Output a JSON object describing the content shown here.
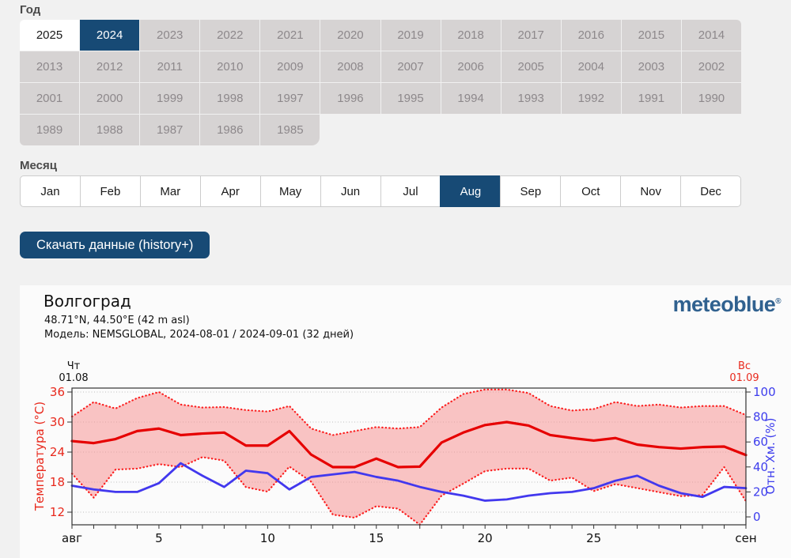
{
  "colors": {
    "accent_navy": "#174a75",
    "page_background": "#f1f1f1",
    "year_cell_gray": "#d6d3d3",
    "temperature_red": "#e8291d",
    "humidity_blue": "#3d3ded",
    "logo_blue": "#30618f"
  },
  "year_section": {
    "label": "Год",
    "selected": "2024",
    "highlighted": "2025",
    "years": [
      "2025",
      "2024",
      "2023",
      "2022",
      "2021",
      "2020",
      "2019",
      "2018",
      "2017",
      "2016",
      "2015",
      "2014",
      "2013",
      "2012",
      "2011",
      "2010",
      "2009",
      "2008",
      "2007",
      "2006",
      "2005",
      "2004",
      "2003",
      "2002",
      "2001",
      "2000",
      "1999",
      "1998",
      "1997",
      "1996",
      "1995",
      "1994",
      "1993",
      "1992",
      "1991",
      "1990",
      "1989",
      "1988",
      "1987",
      "1986",
      "1985"
    ]
  },
  "month_section": {
    "label": "Месяц",
    "selected": "Aug",
    "months": [
      "Jan",
      "Feb",
      "Mar",
      "Apr",
      "May",
      "Jun",
      "Jul",
      "Aug",
      "Sep",
      "Oct",
      "Nov",
      "Dec"
    ]
  },
  "download_button": {
    "label": "Скачать данные (history+)"
  },
  "chart_header": {
    "title": "Волгоград",
    "coords": "48.71°N, 44.50°E (42 m asl)",
    "model": "Модель: NEMSGLOBAL, 2024-08-01 / 2024-09-01 (32 дней)",
    "logo": "meteoblue",
    "logo_mark": "®"
  },
  "chart_data": {
    "type": "line",
    "title": "Волгоград",
    "x_start": "2024-08-01",
    "x_end": "2024-09-01",
    "days_count": 32,
    "grid": true,
    "x_label_start": {
      "weekday": "Чт",
      "date": "01.08",
      "color": "#111111"
    },
    "x_label_end": {
      "weekday": "Вс",
      "date": "01.09",
      "color": "#e8291d"
    },
    "y_left": {
      "label": "Температура (°C)",
      "ticks": [
        36,
        30,
        24,
        18,
        12
      ],
      "color": "#e8291d",
      "ylim": [
        9.3,
        36.8
      ]
    },
    "y_right": {
      "label": "Отн. Хм. (%)",
      "ticks": [
        100,
        80,
        60,
        40,
        20,
        0
      ],
      "color": "#3d3ded",
      "ylim": [
        -6,
        103
      ]
    },
    "x_ticks": [
      {
        "pos": 1,
        "label": "авг"
      },
      {
        "pos": 5,
        "label": "5"
      },
      {
        "pos": 10,
        "label": "10"
      },
      {
        "pos": 15,
        "label": "15"
      },
      {
        "pos": 20,
        "label": "20"
      },
      {
        "pos": 25,
        "label": "25"
      },
      {
        "pos": 32,
        "label": "сен"
      }
    ],
    "band": {
      "between": [
        "temp_max",
        "temp_min"
      ],
      "fill": "rgba(247,140,140,0.5)"
    },
    "series": [
      {
        "name": "temp_mean",
        "axis": "left",
        "style": "solid",
        "color": "#e60000",
        "values": [
          26.2,
          25.8,
          26.6,
          28.2,
          28.7,
          27.4,
          27.7,
          27.9,
          25.3,
          25.3,
          28.2,
          23.5,
          21.0,
          21.0,
          22.7,
          21.0,
          21.1,
          25.9,
          27.9,
          29.4,
          30.0,
          29.3,
          27.4,
          26.8,
          26.3,
          26.8,
          25.5,
          25.0,
          24.7,
          25.0,
          25.1,
          23.4
        ]
      },
      {
        "name": "temp_max",
        "axis": "left",
        "style": "dotted",
        "color": "#fb2020",
        "values": [
          31.1,
          34.0,
          32.7,
          34.8,
          36.0,
          33.5,
          32.9,
          33.0,
          32.4,
          32.1,
          33.2,
          28.7,
          27.4,
          28.2,
          29.0,
          28.7,
          29.0,
          32.9,
          35.6,
          36.5,
          36.5,
          35.8,
          33.2,
          32.3,
          32.6,
          34.0,
          33.2,
          33.5,
          32.9,
          33.2,
          33.2,
          31.4
        ]
      },
      {
        "name": "temp_min",
        "axis": "left",
        "style": "dotted",
        "color": "#fb2020",
        "values": [
          19.7,
          14.9,
          20.5,
          20.7,
          21.6,
          21.0,
          23.0,
          22.3,
          17.0,
          16.1,
          21.1,
          18.1,
          11.5,
          10.9,
          13.2,
          12.7,
          9.5,
          15.3,
          17.7,
          20.2,
          20.7,
          20.7,
          18.3,
          18.9,
          16.2,
          17.6,
          16.8,
          16.0,
          15.2,
          15.4,
          21.0,
          14.2
        ]
      },
      {
        "name": "humidity",
        "axis": "right",
        "style": "solid",
        "color": "#4238ee",
        "values": [
          25,
          22,
          20,
          20,
          27,
          43,
          33,
          24,
          37,
          35,
          22,
          32,
          34,
          36,
          32,
          29,
          24,
          20,
          17,
          13,
          14,
          17,
          19,
          20,
          23,
          29,
          33,
          25,
          19,
          16,
          24,
          23
        ]
      }
    ]
  }
}
